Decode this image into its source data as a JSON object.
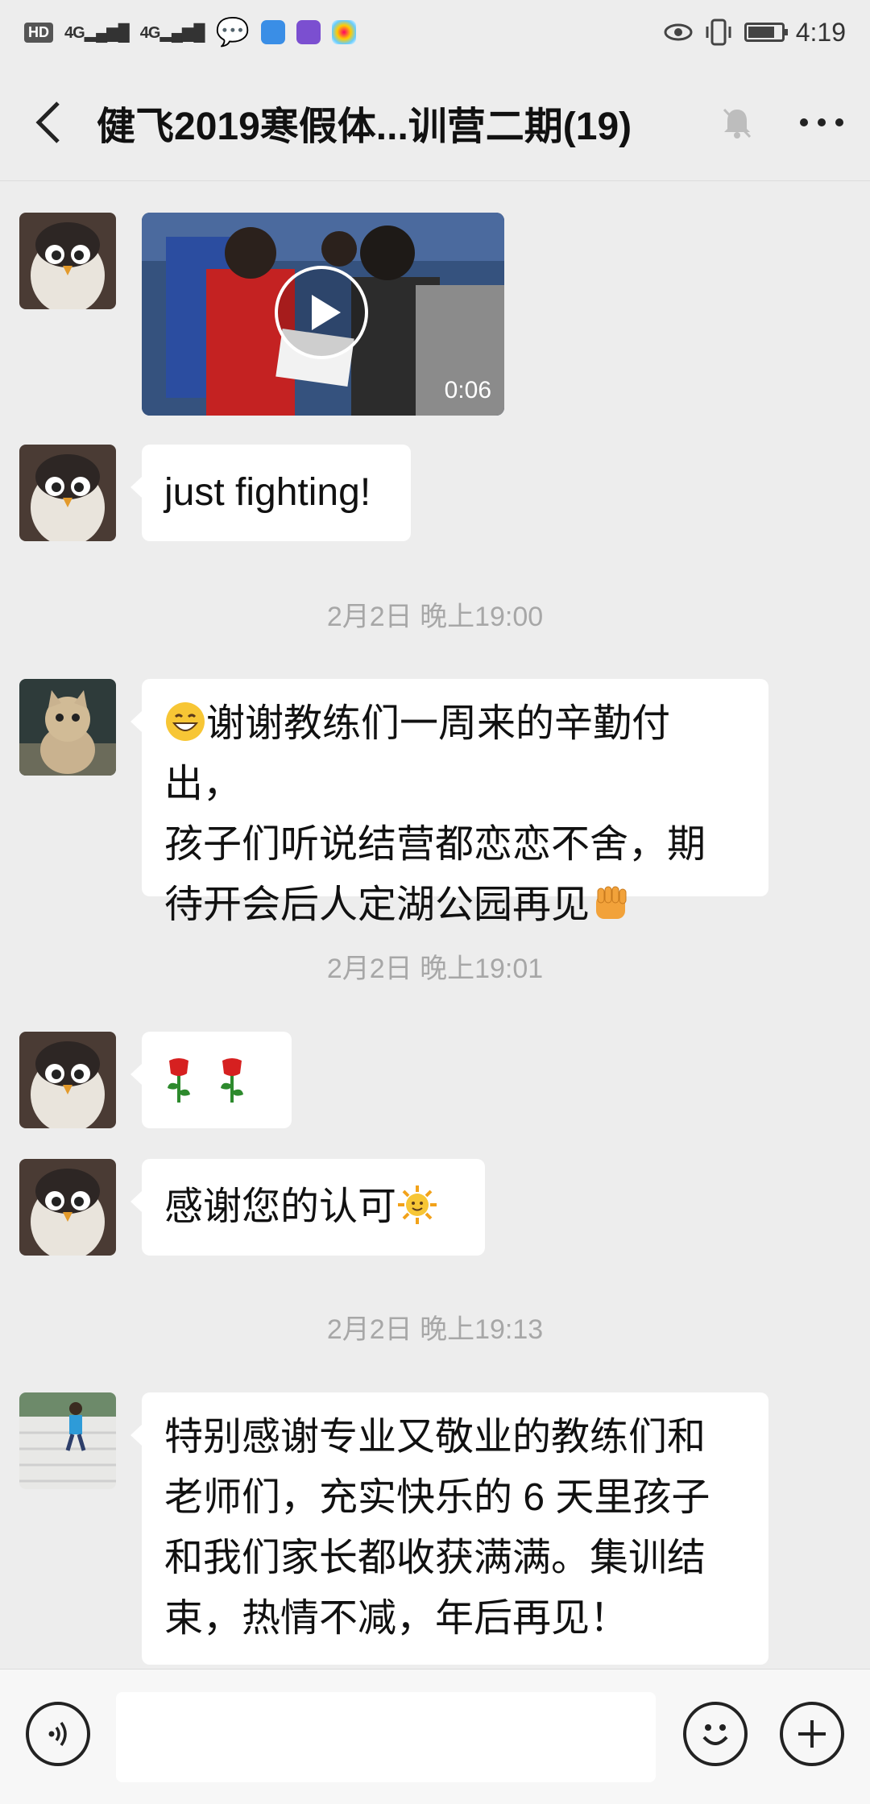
{
  "status_bar": {
    "hd": "HD",
    "sim1": "4G",
    "sim2": "4G",
    "time": "4:19",
    "battery_level": 0.8
  },
  "header": {
    "title": "健飞2019寒假体...训营二期(19)"
  },
  "messages": {
    "m1": {
      "type": "video",
      "duration": "0:06"
    },
    "m2": {
      "type": "text",
      "text": "just fighting!"
    },
    "t1": "2月2日 晚上19:00",
    "m3": {
      "line1": "谢谢教练们一周来的辛勤付出，",
      "line2": "孩子们听说结营都恋恋不舍，期",
      "line3": "待开会后人定湖公园再见"
    },
    "t2": "2月2日 晚上19:01",
    "m4": {
      "type": "emoji",
      "icons": [
        "rose-icon",
        "rose-icon"
      ]
    },
    "m5": {
      "text": "感谢您的认可"
    },
    "t3": "2月2日 晚上19:13",
    "m6": {
      "line1": "特别感谢专业又敬业的教练们和",
      "line2": "老师们，充实快乐的 6 天里孩子",
      "line3": "和我们家长都收获满满。集训结",
      "line4": "束，热情不减，年后再见！"
    }
  },
  "colors": {
    "background": "#ededed",
    "bubble": "#ffffff",
    "timestamp": "#a7a7a7"
  }
}
